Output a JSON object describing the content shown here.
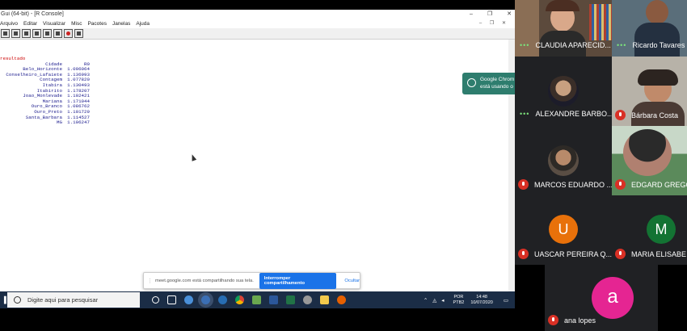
{
  "rgui": {
    "title": "Gui (64-bit) - [R Console]",
    "menu": [
      "Arquivo",
      "Editar",
      "Visualizar",
      "Misc",
      "Pacotes",
      "Janelas",
      "Ajuda"
    ],
    "console": {
      "result_label": "resultado",
      "headers": [
        "Cidade",
        "R0"
      ],
      "rows": [
        [
          "Belo_Horizonte",
          "1.096064"
        ],
        [
          "Conselheiro_Lafaiete",
          "1.136993"
        ],
        [
          "Contagem",
          "1.077820"
        ],
        [
          "Itabira",
          "1.130493"
        ],
        [
          "Itabirito",
          "1.178207"
        ],
        [
          "Joao_Monlevade",
          "1.102421"
        ],
        [
          "Mariana",
          "1.171044"
        ],
        [
          "Ouro_Branco",
          "1.086762"
        ],
        [
          "Ouro_Preto",
          "1.101729"
        ],
        [
          "Santa_Barbara",
          "1.114527"
        ],
        [
          "MG",
          "1.106247"
        ]
      ]
    }
  },
  "notification": {
    "title": "Google Chrom",
    "text": "está usando o"
  },
  "share_bar": {
    "message": "meet.google.com está compartilhando sua tela.",
    "stop_label": "Interromper compartilhamento",
    "hide_label": "Ocultar"
  },
  "taskbar": {
    "search_placeholder": "Digite aqui para pesquisar",
    "lang_line1": "POR",
    "lang_line2": "PTB2",
    "time": "14:48",
    "date": "10/07/2020"
  },
  "participants": [
    {
      "name": "CLAUDIA APARECID...",
      "muted": false,
      "speaking": true
    },
    {
      "name": "Ricardo Tavares",
      "muted": false,
      "speaking": true
    },
    {
      "name": "ALEXANDRE BARBO...",
      "muted": false,
      "speaking": true
    },
    {
      "name": "Bárbara Costa",
      "muted": true
    },
    {
      "name": "MARCOS EDUARDO ...",
      "muted": true
    },
    {
      "name": "EDGARD GREGO",
      "muted": true
    },
    {
      "name": "UASCAR PEREIRA Q...",
      "muted": true,
      "initial": "U",
      "color": "#e8710a"
    },
    {
      "name": "MARIA ELISABE",
      "muted": true,
      "initial": "M",
      "color": "#137333"
    },
    {
      "name": "ana lopes",
      "muted": true,
      "initial": "a",
      "color": "#e52592"
    }
  ],
  "colors": {
    "taskbar": "#1b2d46",
    "stop_button": "#1a73e8",
    "notification": "#2e7d6e",
    "console_output": "#1a1a8c",
    "console_error": "#cc0000"
  }
}
